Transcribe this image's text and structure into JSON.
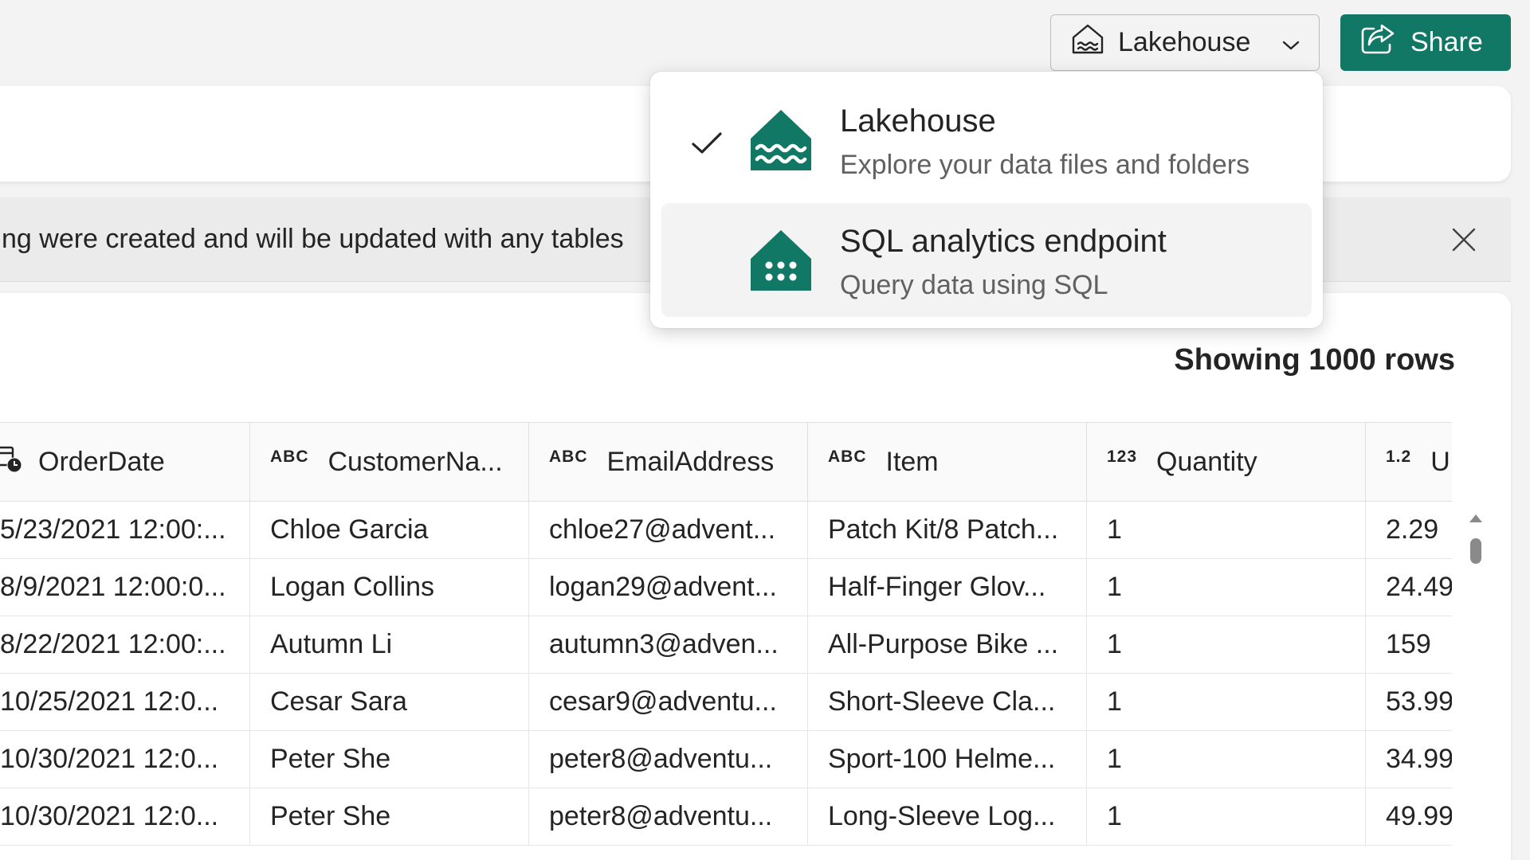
{
  "header": {
    "workspace_switch_label": "Lakehouse",
    "share_label": "Share"
  },
  "banner": {
    "text": "ng were created and will be updated with any tables"
  },
  "view_menu": {
    "items": [
      {
        "title": "Lakehouse",
        "subtitle": "Explore your data files and folders",
        "checked": true,
        "icon": "lakehouse-icon"
      },
      {
        "title": "SQL analytics endpoint",
        "subtitle": "Query data using SQL",
        "checked": false,
        "icon": "sql-endpoint-icon"
      }
    ]
  },
  "table_view": {
    "rows_count_label": "Showing 1000 rows",
    "columns": [
      {
        "name": "OrderDate",
        "type": ""
      },
      {
        "name": "CustomerNa...",
        "type": "ABC"
      },
      {
        "name": "EmailAddress",
        "type": "ABC"
      },
      {
        "name": "Item",
        "type": "ABC"
      },
      {
        "name": "Quantity",
        "type": "123"
      },
      {
        "name": "U",
        "type": "1.2"
      }
    ],
    "rows": [
      [
        "5/23/2021 12:00:...",
        "Chloe Garcia",
        "chloe27@advent...",
        "Patch Kit/8 Patch...",
        "1",
        "2.29"
      ],
      [
        "8/9/2021 12:00:0...",
        "Logan Collins",
        "logan29@advent...",
        "Half-Finger Glov...",
        "1",
        "24.49"
      ],
      [
        "8/22/2021 12:00:...",
        "Autumn Li",
        "autumn3@adven...",
        "All-Purpose Bike ...",
        "1",
        "159"
      ],
      [
        "10/25/2021 12:0...",
        "Cesar Sara",
        "cesar9@adventu...",
        "Short-Sleeve Cla...",
        "1",
        "53.99"
      ],
      [
        "10/30/2021 12:0...",
        "Peter She",
        "peter8@adventu...",
        "Sport-100 Helme...",
        "1",
        "34.99"
      ],
      [
        "10/30/2021 12:0...",
        "Peter She",
        "peter8@adventu...",
        "Long-Sleeve Log...",
        "1",
        "49.99"
      ]
    ]
  },
  "colors": {
    "accent": "#117865",
    "background": "#f3f3f3"
  }
}
